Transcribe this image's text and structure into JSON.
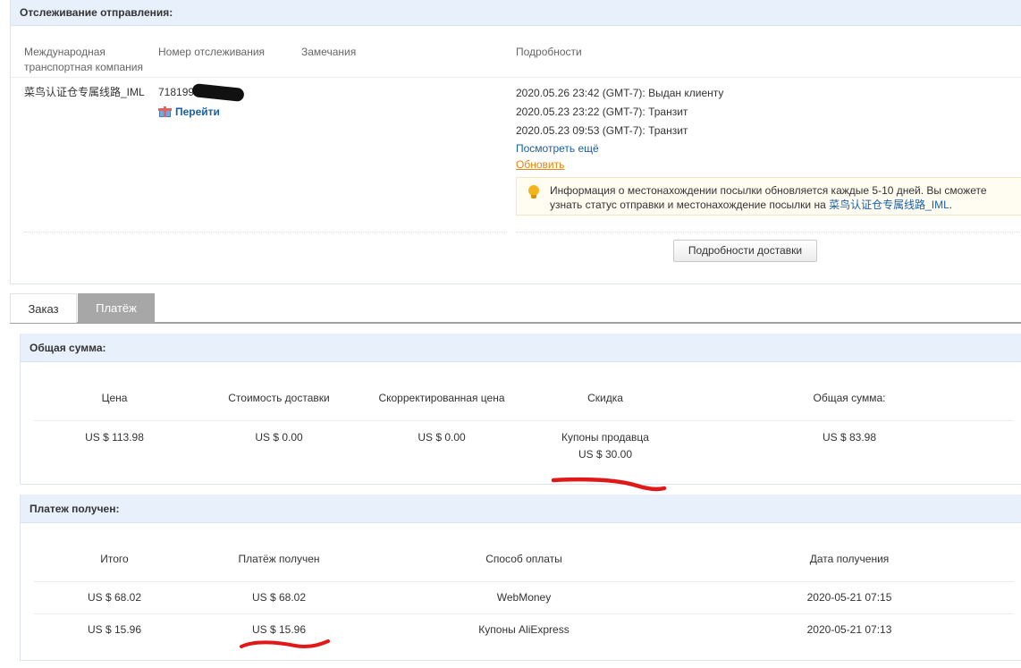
{
  "tracking": {
    "title": "Отслеживание отправления:",
    "headers": {
      "carrier": "Международная транспортная компания",
      "number": "Номер отслеживания",
      "remarks": "Замечания",
      "details": "Подробности"
    },
    "carrier_name": "菜鸟认证仓专属线路_IML",
    "tracking_number": "718199",
    "go_link": "Перейти",
    "events": [
      "2020.05.26 23:42 (GMT-7): Выдан клиенту",
      "2020.05.23 23:22 (GMT-7): Транзит",
      "2020.05.23 09:53 (GMT-7): Транзит"
    ],
    "see_more": "Посмотреть ещё",
    "refresh": "Обновить",
    "info_text_1": "Информация о местонахождении посылки обновляется каждые 5-10 дней. Вы сможете узнать статус отправки и местонахождение посылки на ",
    "info_link": "菜鸟认证仓专属线路_IML",
    "info_text_2": ".",
    "delivery_details_button": "Подробности доставки"
  },
  "tabs": {
    "order": "Заказ",
    "payment": "Платёж"
  },
  "total": {
    "title": "Общая сумма:",
    "headers": [
      "Цена",
      "Стоимость доставки",
      "Скорректированная цена",
      "Скидка",
      "Общая сумма:"
    ],
    "price": "US $ 113.98",
    "shipping": "US $ 0.00",
    "adjusted": "US $ 0.00",
    "discount_label": "Купоны продавца",
    "discount_value": "US $ 30.00",
    "sum": "US $ 83.98"
  },
  "payment": {
    "title": "Платеж получен:",
    "headers": [
      "Итого",
      "Платёж получен",
      "Способ оплаты",
      "Дата получения"
    ],
    "rows": [
      {
        "total": "US $ 68.02",
        "received": "US $ 68.02",
        "method": "WebMoney",
        "date": "2020-05-21 07:15"
      },
      {
        "total": "US $ 15.96",
        "received": "US $ 15.96",
        "method": "Купоны AliExpress",
        "date": "2020-05-21 07:13"
      }
    ]
  },
  "colors": {
    "header_bg": "#e8f1fb",
    "link": "#1a5fa8",
    "refresh_link": "#e8850c",
    "active_tab": "#a7a7a7",
    "annotation_marker": "#e01818"
  }
}
